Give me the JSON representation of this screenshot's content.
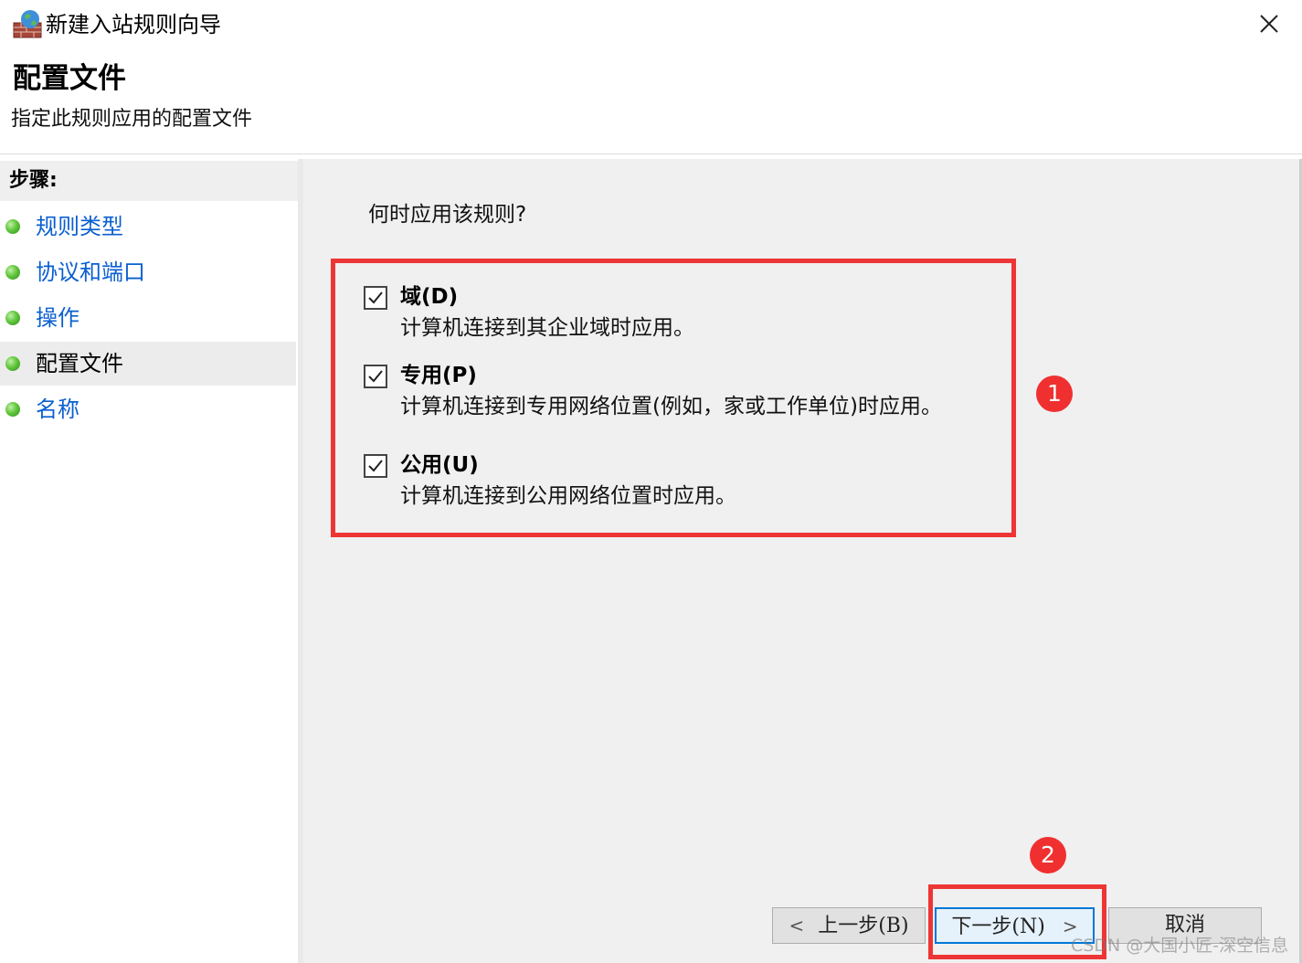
{
  "window": {
    "title": "新建入站规则向导",
    "close_glyph": "✕"
  },
  "header": {
    "title": "配置文件",
    "subtitle": "指定此规则应用的配置文件"
  },
  "sidebar": {
    "steps_label": "步骤:",
    "items": [
      {
        "label": "规则类型",
        "state": "link"
      },
      {
        "label": "协议和端口",
        "state": "link"
      },
      {
        "label": "操作",
        "state": "link"
      },
      {
        "label": "配置文件",
        "state": "current"
      },
      {
        "label": "名称",
        "state": "link"
      }
    ]
  },
  "main": {
    "question": "何时应用该规则?",
    "options": [
      {
        "label": "域(D)",
        "description": "计算机连接到其企业域时应用。",
        "checked": true
      },
      {
        "label": "专用(P)",
        "description": "计算机连接到专用网络位置(例如，家或工作单位)时应用。",
        "checked": true
      },
      {
        "label": "公用(U)",
        "description": "计算机连接到公用网络位置时应用。",
        "checked": true
      }
    ]
  },
  "buttons": {
    "back": "上一步(B)",
    "next": "下一步(N)",
    "cancel": "取消",
    "chevron_left": "<",
    "chevron_right": ">"
  },
  "annotations": {
    "marker_1": "1",
    "marker_2": "2",
    "color": "#ee3535"
  },
  "watermark": "CSDN @大国小匠-深空信息",
  "colors": {
    "link": "#0b5fd0",
    "content_bg": "#f0f0f0",
    "focus_border": "#0078d7"
  }
}
